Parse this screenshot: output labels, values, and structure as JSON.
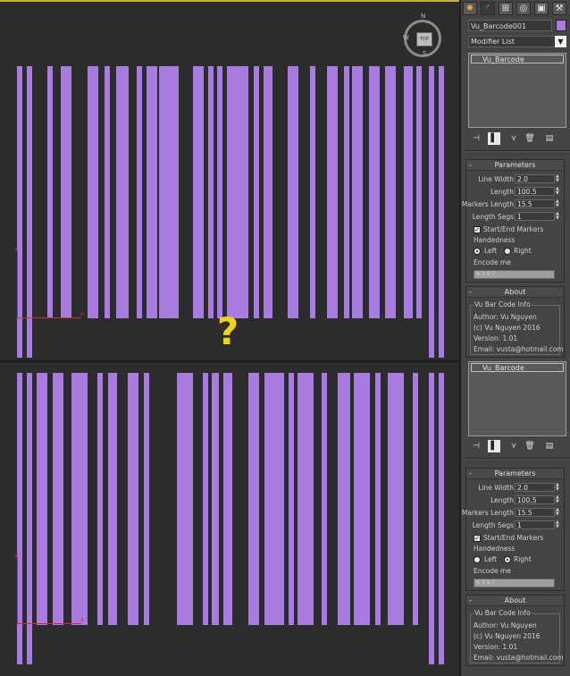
{
  "object_name": "Vu_Barcode001",
  "object_color": "#a77be0",
  "modifier_list": "Modifier List",
  "stack_item": "Vu_Barcode",
  "viewcube": {
    "n": "N",
    "s": "S",
    "w": "W",
    "face": "TOP"
  },
  "axes": {
    "x": "x",
    "y": "y"
  },
  "question_mark": "?",
  "tabs": [
    "create",
    "modify",
    "hierarchy",
    "motion",
    "display",
    "utilities"
  ],
  "stack_tools": [
    "pin-stack",
    "show-end-result",
    "make-unique",
    "remove-modifier",
    "configure-modifier-sets"
  ],
  "top": {
    "params": {
      "title": "Parameters",
      "line_width_label": "Line Width",
      "line_width": "2.0",
      "length_label": "Length",
      "length": "100.5",
      "markers_length_label": "Markers Length",
      "markers_length": "15.5",
      "length_segs_label": "Length Segs",
      "length_segs": "1",
      "start_end_label": "Start/End Markers",
      "handedness_label": "Handedness",
      "left_label": "Left",
      "right_label": "Right",
      "handedness": "Left",
      "encode_label": "Encode me",
      "encode_value": "8 3 9 7"
    }
  },
  "bottom": {
    "params": {
      "title": "Parameters",
      "line_width_label": "Line Width",
      "line_width": "2.0",
      "length_label": "Length",
      "length": "100.5",
      "markers_length_label": "Markers Length",
      "markers_length": "15.5",
      "length_segs_label": "Length Segs",
      "length_segs": "1",
      "start_end_label": "Start/End Markers",
      "handedness_label": "Handedness",
      "left_label": "Left",
      "right_label": "Right",
      "handedness": "Right",
      "encode_label": "Encode me",
      "encode_value": "8 3 9 7"
    }
  },
  "about": {
    "title": "About",
    "heading": "Vu Bar Code Info",
    "author": "Author: Vu Nguyen",
    "copyright": "(c) Vu Nguyen 2016",
    "version": "Version: 1.01",
    "email": "Email: vusta@hotmail.com"
  }
}
